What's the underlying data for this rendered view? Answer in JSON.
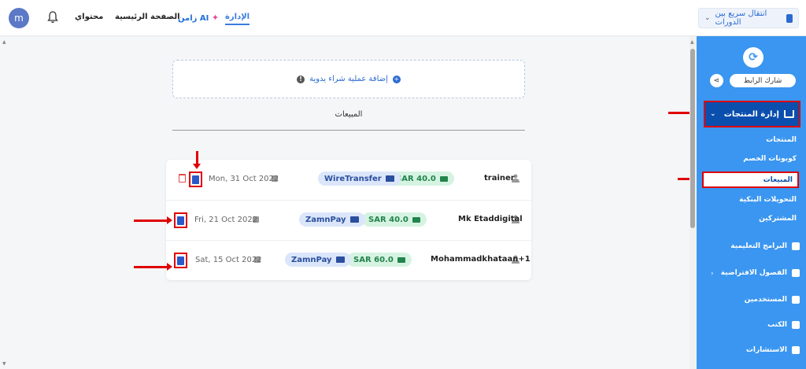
{
  "topbar": {
    "avatar_letter": "m",
    "nav": [
      {
        "label": "محتواي"
      },
      {
        "label": "الصفحة الرئيسية"
      },
      {
        "label": "زامن AI"
      },
      {
        "label": "الإدارة"
      }
    ],
    "quick_switch_label": "انتقال سريع بين الدورات"
  },
  "main": {
    "add_purchase_label": "إضافة عملية شراء يدوية",
    "sales_tab_label": "المبيعات",
    "sales": [
      {
        "user": "trainer",
        "amount": "SAR 40.0",
        "method": "WireTransfer",
        "date": "Mon, 31 Oct 2022",
        "deletable": true
      },
      {
        "user": "Mk Etaddigital",
        "amount": "SAR 40.0",
        "method": "ZamnPay",
        "date": "Fri, 21 Oct 2022",
        "deletable": false
      },
      {
        "user": "Mohammadkhataan+1",
        "amount": "SAR 60.0",
        "method": "ZamnPay",
        "date": "Sat, 15 Oct 2022",
        "deletable": false
      }
    ]
  },
  "sidebar": {
    "share_label": "شارك الرابط",
    "product_management": "إدارة المنتجات",
    "sub_items": [
      "المنتجات",
      "كوبونات الخصم",
      "المبيعات",
      "التحويلات البنكية",
      "المشتركين"
    ],
    "items": [
      "البرامج التعليمية",
      "الفصول الافتراضية",
      "المستخدمين",
      "الكتب",
      "الاستشارات"
    ]
  },
  "colors": {
    "sidebar": "#3a96f0",
    "active": "#0b4fae",
    "annotation": "#e00000",
    "amount_pill": "#d6f3e2",
    "method_pill": "#dbe6fa"
  }
}
